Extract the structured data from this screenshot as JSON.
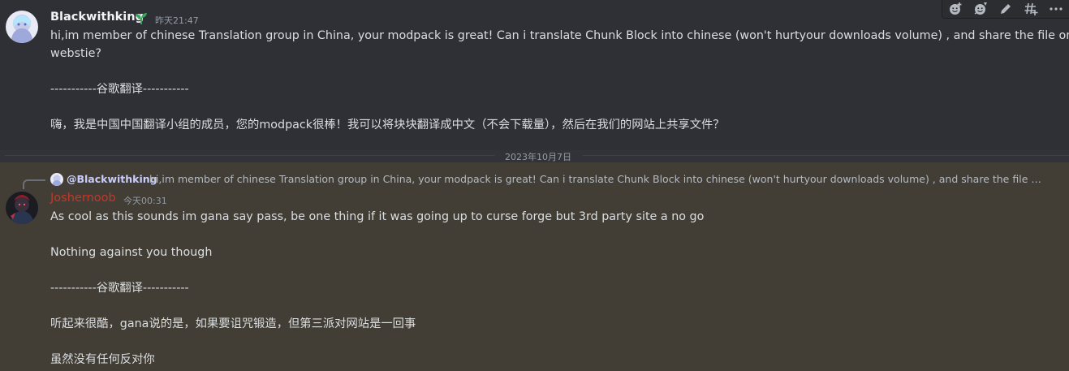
{
  "colors": {
    "accent_green": "#3ba55c",
    "username_red": "#c0392b",
    "reply_name": "#c9cdfb"
  },
  "toolbar": {
    "icons": [
      "add-reaction-icon",
      "add-super-reaction-icon",
      "edit-icon",
      "create-thread-icon",
      "more-icon"
    ]
  },
  "message1": {
    "author": "Blackwithking",
    "timestamp": "昨天21:47",
    "badge": "sprout-badge-icon",
    "lines": [
      "hi,im member of chinese Translation group in China, your modpack is great! Can i translate Chunk Block  into chinese (won't hurtyour downloads volume) , and share the file on our",
      "webstie?",
      "-----------谷歌翻译-----------",
      "嗨，我是中国中国翻译小组的成员，您的modpack很棒！我可以将块块翻译成中文（不会下载量），然后在我们的网站上共享文件？"
    ]
  },
  "divider": {
    "date": "2023年10月7日"
  },
  "message2": {
    "reply": {
      "author": "@Blackwithking",
      "text": "hi,im member of chinese Translation group in China, your modpack is great! Can i translate Chunk Block into chinese (won't hurtyour downloads volume) , and share the file on our webst..."
    },
    "author": "Joshernoob",
    "timestamp": "今天00:31",
    "lines": [
      "As cool as this sounds im gana say pass, be one thing if it was going up to curse forge but 3rd party site a no go",
      "Nothing against you though",
      "-----------谷歌翻译-----------",
      "听起来很酷，gana说的是，如果要诅咒锻造，但第三派对网站是一回事",
      "虽然没有任何反对你"
    ]
  }
}
